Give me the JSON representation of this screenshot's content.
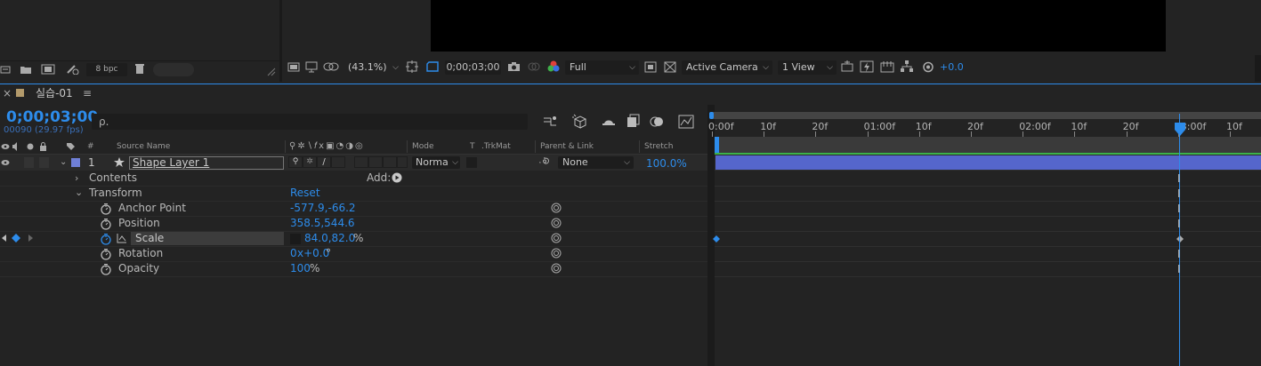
{
  "project_panel": {
    "bpc_label": "8 bpc"
  },
  "viewer_bar": {
    "zoom": "(43.1%)",
    "timecode": "0;00;03;00",
    "resolution": "Full",
    "camera": "Active Camera",
    "views": "1 View",
    "exposure": "+0.0"
  },
  "timeline": {
    "tab_title": "실습-01",
    "timecode": "0;00;03;00",
    "frame_info": "00090 (29.97 fps)",
    "search_placeholder": "ρ.",
    "columns": {
      "source_name": "Source Name",
      "mode": "Mode",
      "t": "T",
      "trkmat": ".TrkMat",
      "parent": "Parent & Link",
      "stretch": "Stretch"
    },
    "layer": {
      "number": "1",
      "name": "Shape Layer 1",
      "mode": "Norma",
      "parent": "None",
      "stretch": "100.0%"
    },
    "add_label": "Add:",
    "contents_label": "Contents",
    "transform_label": "Transform",
    "reset_label": "Reset",
    "properties": [
      {
        "name": "Anchor Point",
        "value": "-577.9,-66.2"
      },
      {
        "name": "Position",
        "value": "358.5,544.6"
      },
      {
        "name": "Scale",
        "value": "84.0,82.0",
        "unit": "%"
      },
      {
        "name": "Rotation",
        "value_a": "0",
        "value_b": "x+0.0",
        "unit": "°"
      },
      {
        "name": "Opacity",
        "value": "100",
        "unit": "%"
      }
    ],
    "ruler_ticks": [
      "0:00f",
      "10f",
      "20f",
      "01:00f",
      "10f",
      "20f",
      "02:00f",
      "10f",
      "20f",
      "03:00f",
      "10f"
    ],
    "playhead_frame": 90,
    "colors": {
      "accent": "#2d8ceb",
      "layer_bar": "#5566cc",
      "layer_label": "#6f7fd6"
    }
  }
}
